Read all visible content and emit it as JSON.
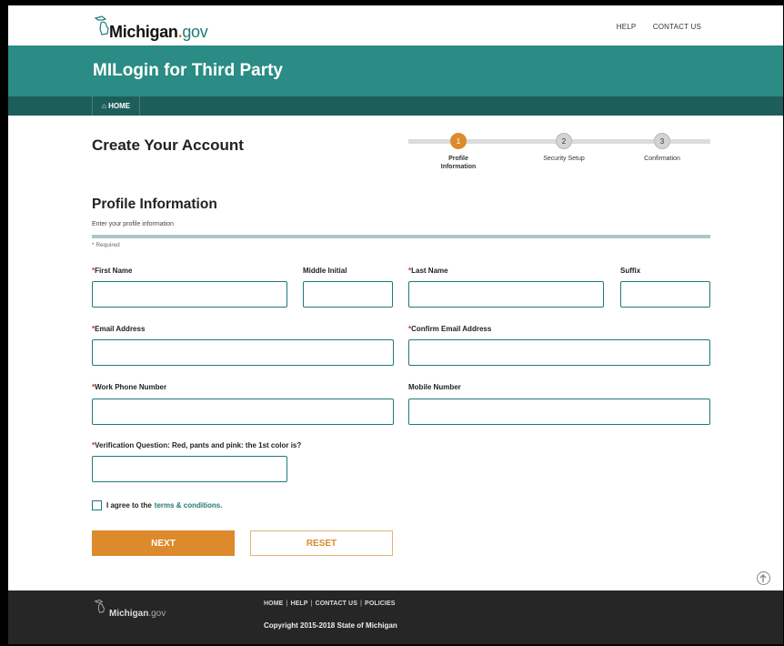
{
  "header": {
    "logo_main": "Michigan",
    "logo_dot": ".",
    "logo_suffix": "gov",
    "help": "HELP",
    "contact": "CONTACT US"
  },
  "banner": {
    "title": "MILogin for Third Party"
  },
  "nav": {
    "home": "HOME"
  },
  "page": {
    "title": "Create Your Account"
  },
  "steps": [
    {
      "num": "1",
      "label": "Profile Information",
      "active": true
    },
    {
      "num": "2",
      "label": "Security Setup",
      "active": false
    },
    {
      "num": "3",
      "label": "Confirmation",
      "active": false
    }
  ],
  "section": {
    "title": "Profile Information",
    "subtitle": "Enter your profile information",
    "required_note": "Required"
  },
  "fields": {
    "first_name": "First Name",
    "middle_initial": "Middle Initial",
    "last_name": "Last Name",
    "suffix": "Suffix",
    "email": "Email Address",
    "confirm_email": "Confirm Email Address",
    "work_phone": "Work Phone Number",
    "mobile": "Mobile Number",
    "verification": "Verification Question: Red, pants and pink: the 1st color is?"
  },
  "agree": {
    "text": "I agree to the",
    "link": "terms & conditions."
  },
  "buttons": {
    "next": "NEXT",
    "reset": "RESET"
  },
  "footer": {
    "logo_main": "Michigan",
    "logo_suffix": ".gov",
    "links": [
      "HOME",
      "HELP",
      "CONTACT US",
      "POLICIES"
    ],
    "copyright": "Copyright 2015-2018 State of Michigan"
  },
  "colors": {
    "teal": "#2a8c84",
    "dark_teal": "#1d5e5a",
    "accent_orange": "#dc8a2c"
  },
  "icons": {
    "home": "home-icon",
    "scroll_top": "arrow-up-circle-icon"
  }
}
